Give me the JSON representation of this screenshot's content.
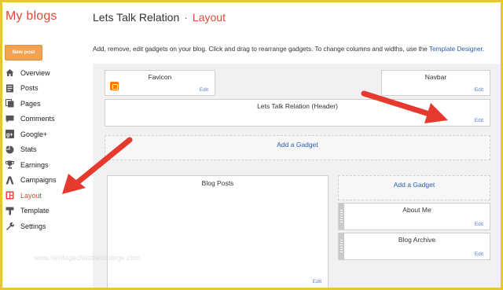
{
  "header": {
    "my_blogs": "My blogs",
    "blog_name": "Lets Talk Relation",
    "separator": "·",
    "page_name": "Layout"
  },
  "sidebar": {
    "new_post": "New post",
    "items": [
      {
        "label": "Overview",
        "icon": "home-icon"
      },
      {
        "label": "Posts",
        "icon": "posts-icon"
      },
      {
        "label": "Pages",
        "icon": "pages-icon"
      },
      {
        "label": "Comments",
        "icon": "comments-icon"
      },
      {
        "label": "Google+",
        "icon": "google-plus-icon"
      },
      {
        "label": "Stats",
        "icon": "stats-icon"
      },
      {
        "label": "Earnings",
        "icon": "trophy-icon"
      },
      {
        "label": "Campaigns",
        "icon": "campaigns-icon"
      },
      {
        "label": "Layout",
        "icon": "layout-icon",
        "active": true
      },
      {
        "label": "Template",
        "icon": "template-icon"
      },
      {
        "label": "Settings",
        "icon": "wrench-icon"
      }
    ]
  },
  "main": {
    "description": "Add, remove, edit gadgets on your blog. Click and drag to rearrange gadgets. To change columns and widths, use the ",
    "description_link": "Template Designer",
    "description_end": ".",
    "favicon": {
      "title": "Favicon",
      "edit": "Edit"
    },
    "navbar": {
      "title": "Navbar",
      "edit": "Edit"
    },
    "header_gadget": {
      "title": "Lets Talk Relation (Header)",
      "edit": "Edit"
    },
    "add_gadget_top": "Add a Gadget",
    "blog_posts": {
      "title": "Blog Posts",
      "edit": "Edit"
    },
    "add_gadget_side": "Add a Gadget",
    "about_me": {
      "title": "About Me",
      "edit": "Edit"
    },
    "blog_archive": {
      "title": "Blog Archive",
      "edit": "Edit"
    }
  },
  "watermark": "www.heritagechristiancollege.com",
  "colors": {
    "frame_border": "#e8c72e",
    "accent": "#dd4b39",
    "link": "#2a5db0",
    "arrow": "#e63a2e"
  }
}
